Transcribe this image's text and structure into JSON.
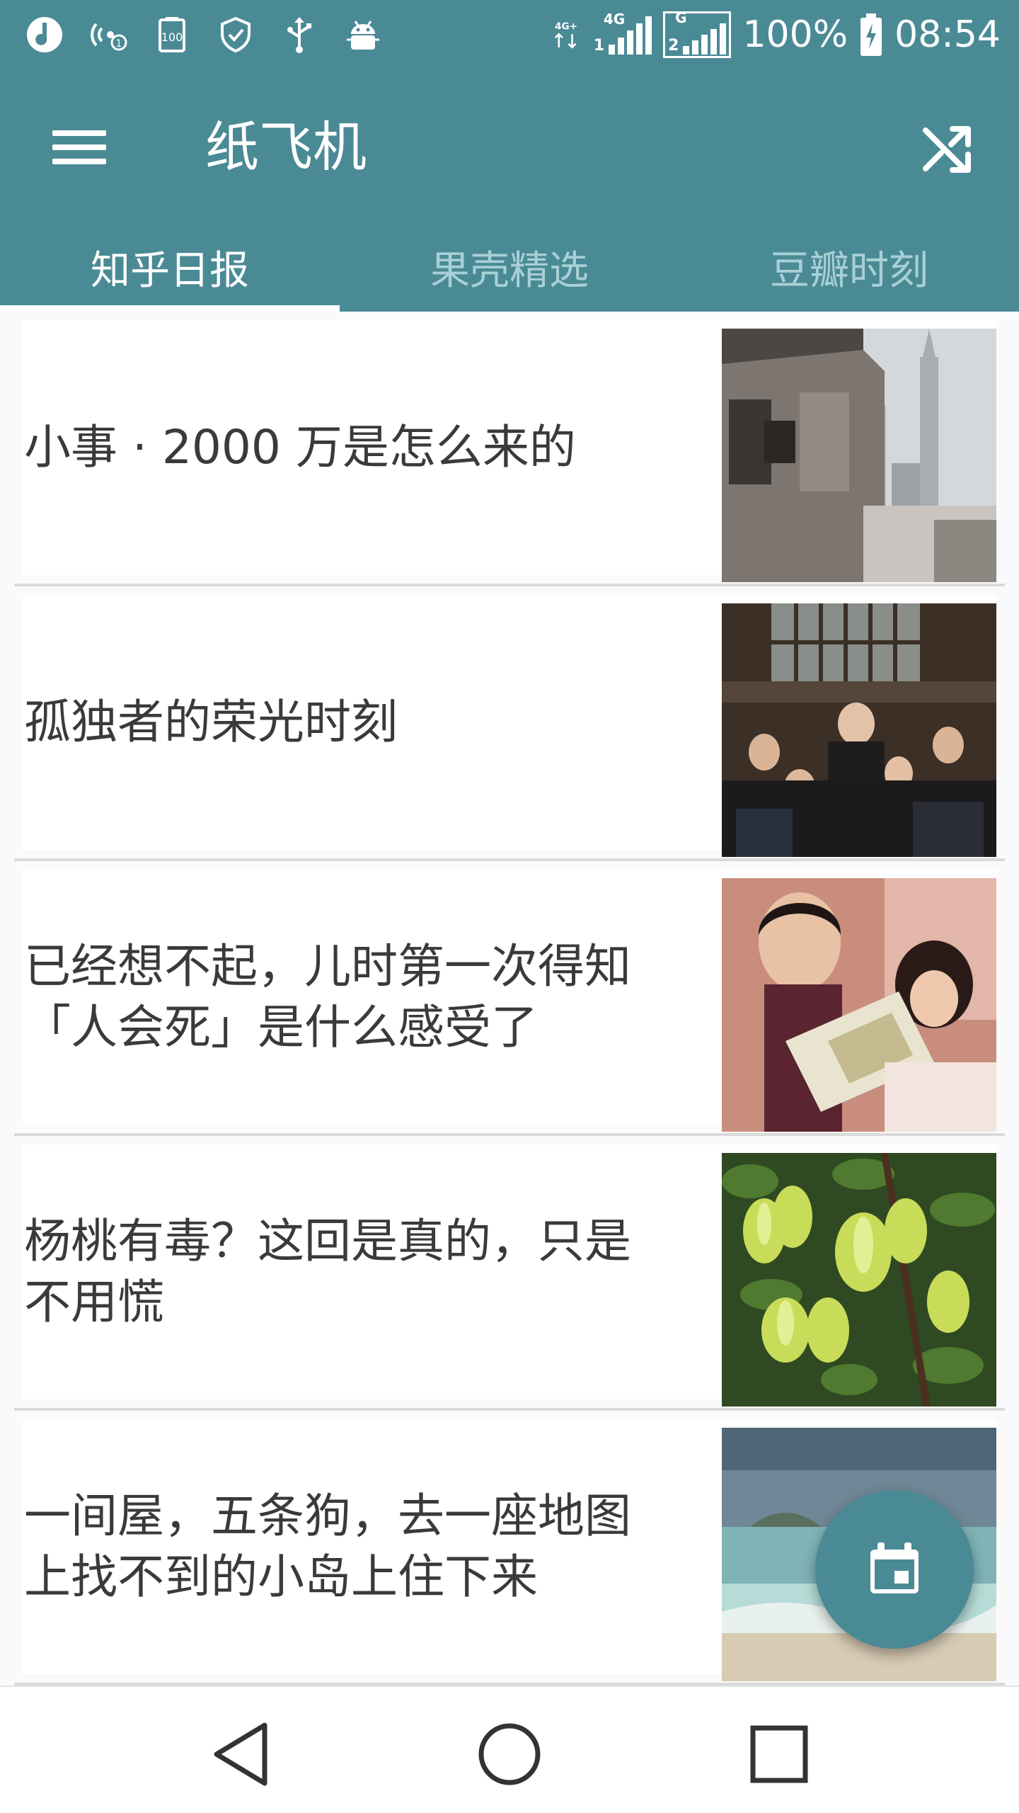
{
  "status_bar": {
    "battery": "100%",
    "time": "08:54",
    "left_icons": [
      "music-app-icon",
      "hotspot-icon",
      "storage-100-icon",
      "shield-icon",
      "usb-icon",
      "android-debug-icon"
    ],
    "signal": {
      "sim1_label": "4G",
      "sim1_slot": "1",
      "sim2_label": "G",
      "sim2_slot": "2",
      "data_label": "4G+"
    },
    "background": "#4a8a95"
  },
  "toolbar": {
    "title": "纸飞机",
    "menu_icon": "menu-icon",
    "shuffle_icon": "shuffle-icon"
  },
  "tabs": [
    {
      "label": "知乎日报",
      "active": true
    },
    {
      "label": "果壳精选",
      "active": false
    },
    {
      "label": "豆瓣时刻",
      "active": false
    }
  ],
  "articles": [
    {
      "title": "小事 · 2000 万是怎么来的",
      "image": "old-building-and-skyscrapers"
    },
    {
      "title": "孤独者的荣光时刻",
      "image": "meeting-hall-applause"
    },
    {
      "title": "已经想不起，儿时第一次得知\n「人会死」是什么感受了",
      "image": "father-reading-book-to-girl"
    },
    {
      "title": "杨桃有毒？这回是真的，只是\n不用慌",
      "image": "starfruit-on-tree"
    },
    {
      "title": "一间屋，五条狗，去一座地图\n上找不到的小岛上住下来",
      "image": "beach-and-sea"
    }
  ],
  "fab": {
    "icon": "calendar-icon"
  },
  "nav": [
    "back-icon",
    "home-icon",
    "recents-icon"
  ],
  "colors": {
    "primary": "#4a8a95",
    "tab_inactive": "#a8d0d6",
    "card_text": "#3a3a3a"
  }
}
